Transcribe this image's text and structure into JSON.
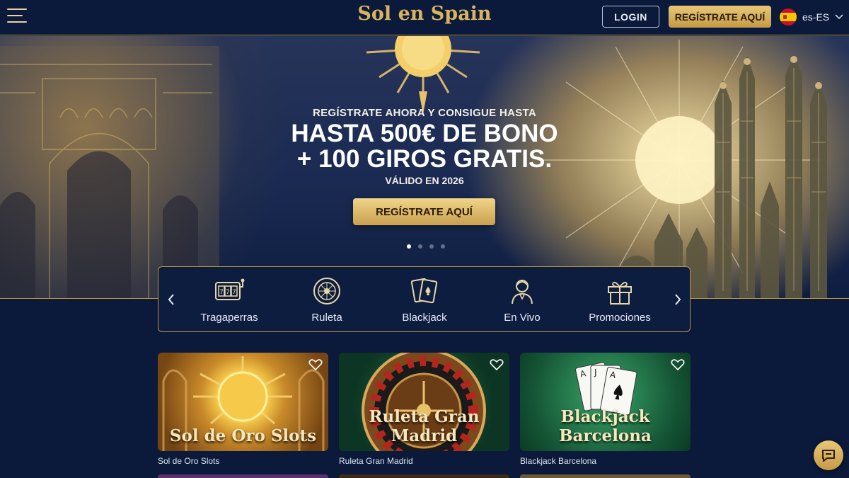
{
  "header": {
    "logo_text": "Sol en Spain",
    "login_label": "LOGIN",
    "register_label": "REGÍSTRATE AQUÍ",
    "language_label": "es-ES",
    "language_flag_icon": "spain-flag-icon",
    "menu_icon": "hamburger-menu-icon"
  },
  "hero": {
    "pretitle": "REGÍSTRATE AHORA Y CONSIGUE HASTA",
    "headline_line1": "HASTA 500€ DE BONO",
    "headline_line2": "+ 100 GIROS GRATIS.",
    "validity": "VÁLIDO EN 2026",
    "cta_label": "REGÍSTRATE AQUÍ",
    "slides_total": 4,
    "active_slide": 1
  },
  "categories": {
    "items": [
      {
        "label": "Tragaperras",
        "icon": "slot-machine-icon"
      },
      {
        "label": "Ruleta",
        "icon": "roulette-wheel-icon"
      },
      {
        "label": "Blackjack",
        "icon": "playing-cards-icon"
      },
      {
        "label": "En Vivo",
        "icon": "live-dealer-icon"
      },
      {
        "label": "Promociones",
        "icon": "gift-icon"
      }
    ],
    "prev_icon": "chevron-left-icon",
    "next_icon": "chevron-right-icon"
  },
  "games": [
    {
      "thumb_title": "Sol de Oro Slots",
      "caption": "Sol de Oro Slots",
      "favorite_icon": "heart-icon"
    },
    {
      "thumb_title": "Ruleta Gran Madrid",
      "caption": "Ruleta Gran Madrid",
      "favorite_icon": "heart-icon"
    },
    {
      "thumb_title": "Blackjack Barcelona",
      "caption": "Blackjack Barcelona",
      "favorite_icon": "heart-icon"
    }
  ],
  "chat": {
    "icon": "chat-bubble-icon"
  },
  "colors": {
    "navy_background": "#0b1a3a",
    "gold_accent": "#c69a45",
    "gold_light": "#e8c777"
  }
}
